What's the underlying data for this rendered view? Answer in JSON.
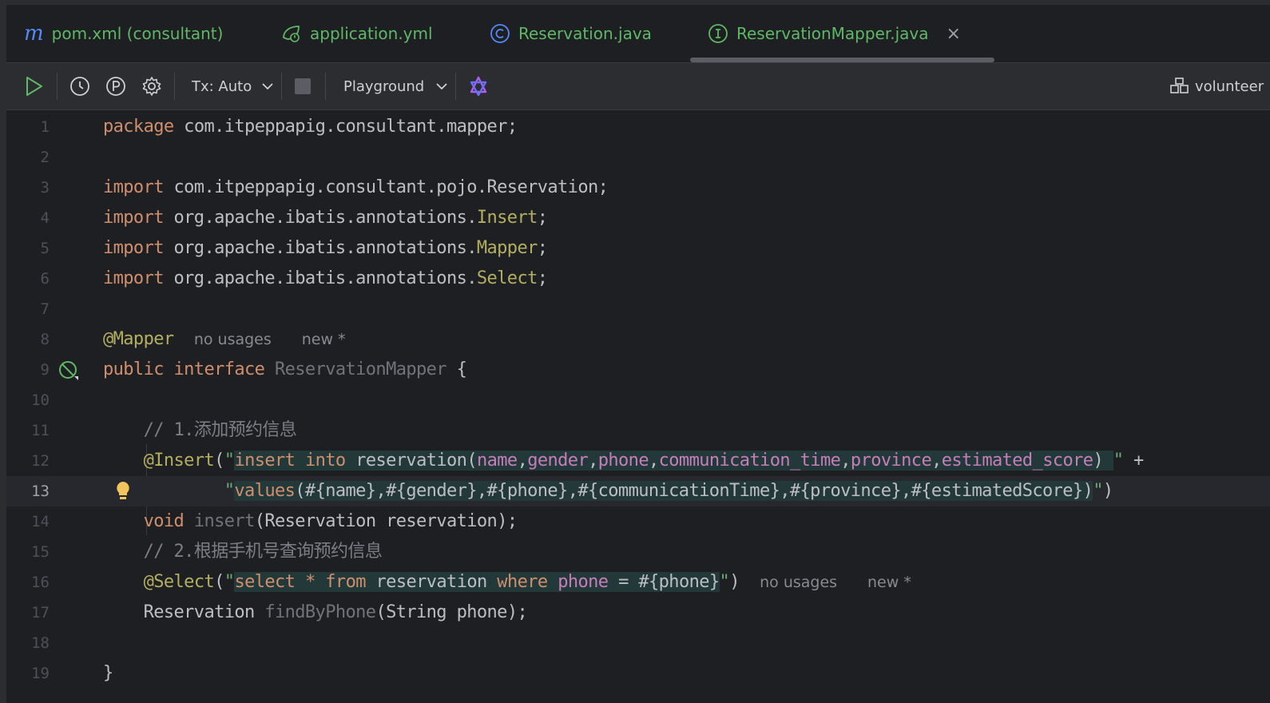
{
  "tabs": [
    {
      "label": "pom.xml (consultant)",
      "icon": "maven-m-icon"
    },
    {
      "label": "application.yml",
      "icon": "spring-config-icon"
    },
    {
      "label": "Reservation.java",
      "icon": "class-icon"
    },
    {
      "label": "ReservationMapper.java",
      "icon": "interface-icon",
      "active": true
    }
  ],
  "toolbar": {
    "tx_label": "Tx: Auto",
    "playground_label": "Playground",
    "datasource_label": "volunteer"
  },
  "editor": {
    "line_numbers": [
      "1",
      "2",
      "3",
      "4",
      "5",
      "6",
      "7",
      "8",
      "9",
      "10",
      "11",
      "12",
      "13",
      "14",
      "15",
      "16",
      "17",
      "18",
      "19"
    ],
    "current_line": "13",
    "hints": {
      "no_usages": "no usages",
      "new": "new *"
    },
    "comment1": "// 1.添加预约信息",
    "comment2": "// 2.根据手机号查询预约信息"
  },
  "colors": {
    "background": "#1e1f22",
    "keyword": "#cf8e6d",
    "annotation": "#b3ae60",
    "string": "#6aab73",
    "column": "#c77dbb",
    "tab_text": "#5fb865"
  }
}
